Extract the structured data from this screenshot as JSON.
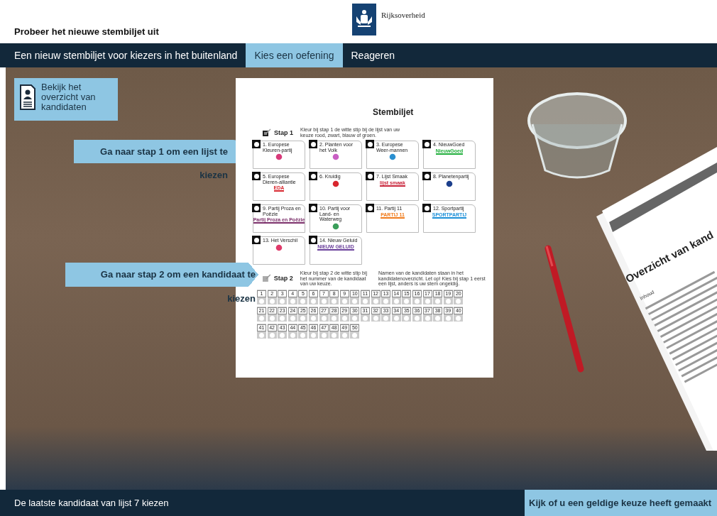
{
  "header": {
    "title": "Probeer het nieuwe stembiljet uit",
    "logo_text": "Rijksoverheid"
  },
  "tabs": [
    {
      "label": "Een nieuw stembiljet voor kiezers in het buitenland",
      "selected": false
    },
    {
      "label": "Kies een oefening",
      "selected": true
    },
    {
      "label": "Reageren",
      "selected": false
    }
  ],
  "candidate_overview_button": {
    "label": "Bekijk het overzicht van kandidaten"
  },
  "callouts": [
    {
      "text": "Ga naar stap 1 om een lijst te kiezen",
      "kind": "round"
    },
    {
      "text": "Ga naar stap 2 om een kandidaat te kiezen",
      "kind": "pointed"
    }
  ],
  "ballot": {
    "title": "Stembiljet",
    "step1": {
      "label": "Stap 1",
      "instruction": "Kleur bij stap 1 de witte stip bij de lijst van uw keuze rood, zwart, blauw of groen."
    },
    "parties": [
      {
        "name": "1. Europese Kleuren-partij",
        "color": "#d83a7a"
      },
      {
        "name": "2. Planten voor het Volk",
        "color": "#c95fc4"
      },
      {
        "name": "3. Europese Weer-mannen",
        "color": "#2a8fd0"
      },
      {
        "name": "4. NieuwGoed",
        "logo": "NieuwGoed",
        "color": "#1fae3a"
      },
      {
        "name": "5. Europese Dieren-alliantie",
        "logo": "EDA",
        "color": "#d8262e"
      },
      {
        "name": "6. Kruidig",
        "color": "#d8262e"
      },
      {
        "name": "7. Lijst Smaak",
        "logo": "lijst smaak",
        "color": "#c9243a"
      },
      {
        "name": "8. Planetenpartij",
        "color": "#1c3f8c"
      },
      {
        "name": "9. Partij Proza en Poëzie",
        "logo": "Partij Proza en Poëzie",
        "color": "#7b2f6a"
      },
      {
        "name": "10. Partij voor Land- en Waterweg",
        "color": "#3a9e5a"
      },
      {
        "name": "11. Partij 11",
        "logo": "PARTIJ 11",
        "color": "#f07a1a"
      },
      {
        "name": "12. Sportpartij",
        "logo": "SPORTPARTIJ",
        "color": "#1a8fd8"
      },
      {
        "name": "13. Het Verschil",
        "color": "#e03a6a"
      },
      {
        "name": "14. Nieuw Geluid",
        "logo": "NIEUW GELUID",
        "color": "#6a3f9a"
      }
    ],
    "step2": {
      "label": "Stap 2",
      "instruction": "Kleur bij stap 2 de witte stip bij het nummer van de kandidaat van uw keuze.",
      "note": "Namen van de kandidaten staan in het kandidatenoverzicht. Let op! Kies bij stap 1 eerst een lijst, anders is uw stem ongeldig."
    },
    "candidates": [
      "1",
      "2",
      "3",
      "4",
      "5",
      "6",
      "7",
      "8",
      "9",
      "10",
      "11",
      "12",
      "13",
      "14",
      "15",
      "16",
      "17",
      "18",
      "19",
      "20",
      "21",
      "22",
      "23",
      "24",
      "25",
      "26",
      "27",
      "28",
      "29",
      "30",
      "31",
      "32",
      "33",
      "34",
      "35",
      "36",
      "37",
      "38",
      "39",
      "40",
      "41",
      "42",
      "43",
      "44",
      "45",
      "46",
      "47",
      "48",
      "49",
      "50"
    ]
  },
  "overview_paper": {
    "title": "Overzicht van kand",
    "heading": "Inhoud"
  },
  "status_bar": {
    "text": "De laatste kandidaat van lijst 7 kiezen",
    "button": "Kijk of u een geldige keuze heeft gemaakt"
  }
}
